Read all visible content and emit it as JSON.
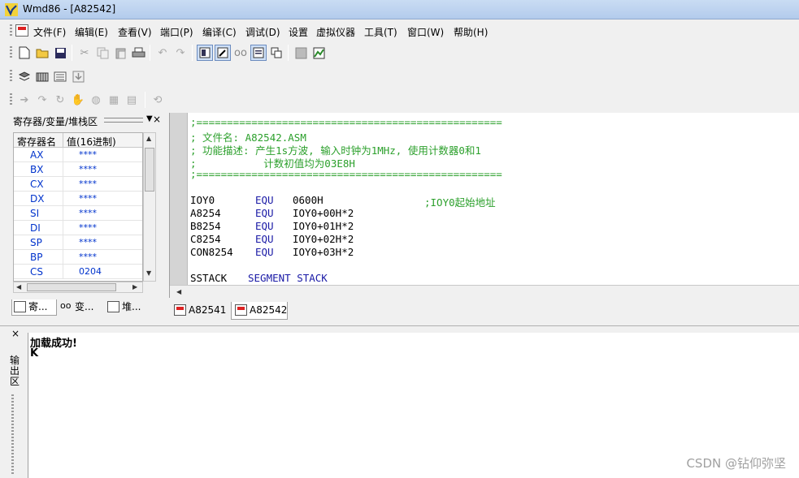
{
  "window": {
    "title": "Wmd86 - [A82542]"
  },
  "menu": {
    "items": [
      "文件(F)",
      "编辑(E)",
      "查看(V)",
      "端口(P)",
      "编译(C)",
      "调试(D)",
      "设置",
      "虚拟仪器",
      "工具(T)",
      "窗口(W)",
      "帮助(H)"
    ]
  },
  "registers_panel": {
    "title": "寄存器/变量/堆栈区",
    "col_name": "寄存器名",
    "col_value": "值(16进制)",
    "rows": [
      {
        "name": "AX",
        "value": "****"
      },
      {
        "name": "BX",
        "value": "****"
      },
      {
        "name": "CX",
        "value": "****"
      },
      {
        "name": "DX",
        "value": "****"
      },
      {
        "name": "SI",
        "value": "****"
      },
      {
        "name": "DI",
        "value": "****"
      },
      {
        "name": "SP",
        "value": "****"
      },
      {
        "name": "BP",
        "value": "****"
      },
      {
        "name": "CS",
        "value": "0204"
      }
    ],
    "tabs": [
      "寄...",
      "变...",
      "堆..."
    ]
  },
  "editor": {
    "lines": {
      "l1": ";==================================================",
      "l2": "; 文件名: A82542.ASM",
      "l3": "; 功能描述: 产生1s方波, 输入时钟为1MHz, 使用计数器0和1",
      "l4": ";           计数初值均为03E8H",
      "l5": ";==================================================",
      "l7_label": "IOY0",
      "l7_op": "EQU",
      "l7_arg": "0600H",
      "l7_comment": ";IOY0起始地址",
      "l8_label": "A8254",
      "l8_op": "EQU",
      "l8_arg": "IOY0+00H*2",
      "l9_label": "B8254",
      "l9_op": "EQU",
      "l9_arg": "IOY0+01H*2",
      "l10_label": "C8254",
      "l10_op": "EQU",
      "l10_arg": "IOY0+02H*2",
      "l11_label": "CON8254",
      "l11_op": "EQU",
      "l11_arg": "IOY0+03H*2",
      "l13_label": "SSTACK",
      "l13_op": "SEGMENT STACK"
    },
    "tabs": [
      "A82541",
      "A82542"
    ],
    "active_tab": "A82542"
  },
  "output": {
    "side_label": "输出区",
    "lines": [
      "加载成功!",
      "K"
    ]
  },
  "watermark": "CSDN @钻仰弥坚"
}
